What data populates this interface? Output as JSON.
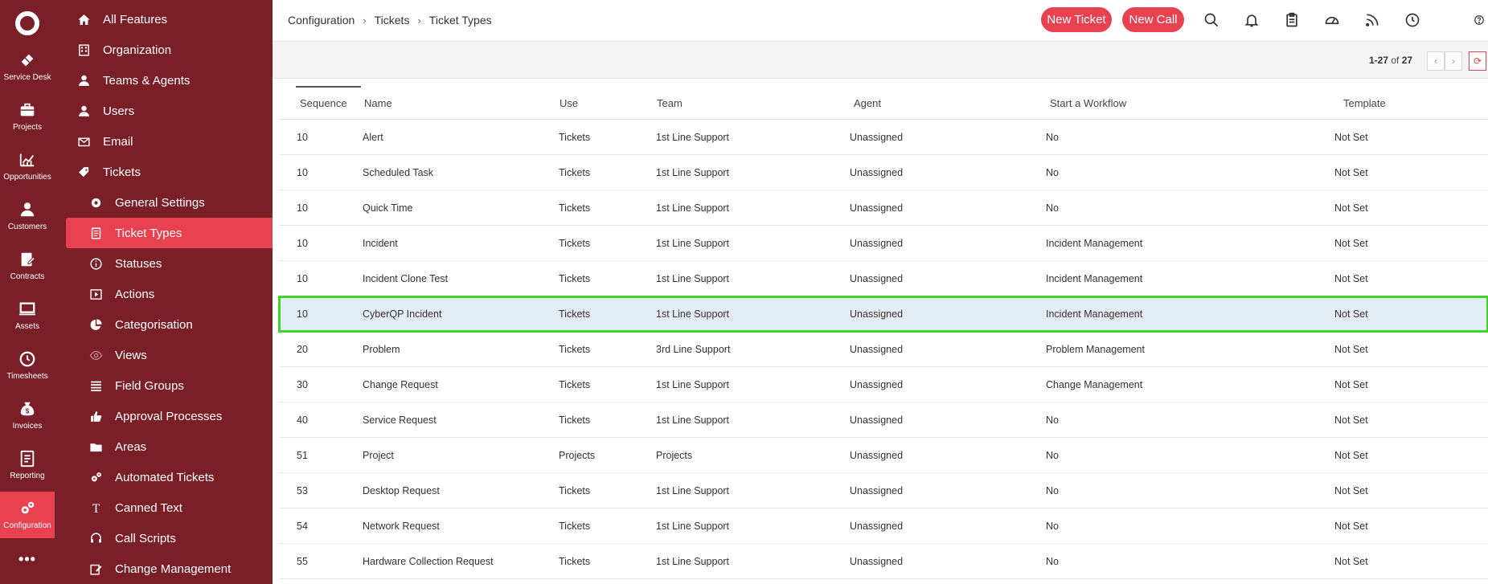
{
  "rail": [
    {
      "label": "Service Desk",
      "icon": "ticket-icon"
    },
    {
      "label": "Projects",
      "icon": "briefcase-icon"
    },
    {
      "label": "Opportunities",
      "icon": "chart-icon"
    },
    {
      "label": "Customers",
      "icon": "person-icon"
    },
    {
      "label": "Contracts",
      "icon": "contract-icon"
    },
    {
      "label": "Assets",
      "icon": "monitor-icon"
    },
    {
      "label": "Timesheets",
      "icon": "clock-icon"
    },
    {
      "label": "Invoices",
      "icon": "money-bag-icon"
    },
    {
      "label": "Reporting",
      "icon": "report-icon"
    },
    {
      "label": "Configuration",
      "icon": "gears-icon",
      "active": true
    }
  ],
  "rail_more": "•••",
  "nav": [
    {
      "label": "All Features",
      "icon": "home-icon",
      "level": 1
    },
    {
      "label": "Organization",
      "icon": "building-icon",
      "level": 1
    },
    {
      "label": "Teams & Agents",
      "icon": "person-icon",
      "level": 1
    },
    {
      "label": "Users",
      "icon": "user-icon",
      "level": 1
    },
    {
      "label": "Email",
      "icon": "envelope-icon",
      "level": 1
    },
    {
      "label": "Tickets",
      "icon": "tag-icon",
      "level": 1
    },
    {
      "label": "General Settings",
      "icon": "gear-icon",
      "level": 2
    },
    {
      "label": "Ticket Types",
      "icon": "document-icon",
      "level": 2,
      "active": true
    },
    {
      "label": "Statuses",
      "icon": "info-icon",
      "level": 2
    },
    {
      "label": "Actions",
      "icon": "play-icon",
      "level": 2
    },
    {
      "label": "Categorisation",
      "icon": "pie-icon",
      "level": 2
    },
    {
      "label": "Views",
      "icon": "eye-icon",
      "level": 2
    },
    {
      "label": "Field Groups",
      "icon": "list-icon",
      "level": 2
    },
    {
      "label": "Approval Processes",
      "icon": "thumbs-up-icon",
      "level": 2
    },
    {
      "label": "Areas",
      "icon": "folder-icon",
      "level": 2
    },
    {
      "label": "Automated Tickets",
      "icon": "gears-icon",
      "level": 2
    },
    {
      "label": "Canned Text",
      "icon": "text-icon",
      "level": 2
    },
    {
      "label": "Call Scripts",
      "icon": "headset-icon",
      "level": 2
    },
    {
      "label": "Change Management",
      "icon": "edit-icon",
      "level": 2
    }
  ],
  "header": {
    "breadcrumb": [
      "Configuration",
      "Tickets",
      "Ticket Types"
    ],
    "new_ticket_label": "New Ticket",
    "new_call_label": "New Call",
    "icons": [
      "search-icon",
      "bell-icon",
      "clipboard-icon",
      "gauge-icon",
      "rss-icon",
      "clock-icon",
      "help-icon"
    ]
  },
  "toolbar": {
    "range": "1-27",
    "of_label": "of",
    "total": "27",
    "prev": "‹",
    "next": "›",
    "refresh": "⟳"
  },
  "table": {
    "columns": [
      "Sequence",
      "Name",
      "Use",
      "Team",
      "Agent",
      "Start a Workflow",
      "Template"
    ],
    "rows": [
      [
        "10",
        "Alert",
        "Tickets",
        "1st Line Support",
        "Unassigned",
        "No",
        "Not Set"
      ],
      [
        "10",
        "Scheduled Task",
        "Tickets",
        "1st Line Support",
        "Unassigned",
        "No",
        "Not Set"
      ],
      [
        "10",
        "Quick Time",
        "Tickets",
        "1st Line Support",
        "Unassigned",
        "No",
        "Not Set"
      ],
      [
        "10",
        "Incident",
        "Tickets",
        "1st Line Support",
        "Unassigned",
        "Incident Management",
        "Not Set"
      ],
      [
        "10",
        "Incident Clone Test",
        "Tickets",
        "1st Line Support",
        "Unassigned",
        "Incident Management",
        "Not Set"
      ],
      [
        "10",
        "CyberQP Incident",
        "Tickets",
        "1st Line Support",
        "Unassigned",
        "Incident Management",
        "Not Set"
      ],
      [
        "20",
        "Problem",
        "Tickets",
        "3rd Line Support",
        "Unassigned",
        "Problem Management",
        "Not Set"
      ],
      [
        "30",
        "Change Request",
        "Tickets",
        "1st Line Support",
        "Unassigned",
        "Change Management",
        "Not Set"
      ],
      [
        "40",
        "Service Request",
        "Tickets",
        "1st Line Support",
        "Unassigned",
        "No",
        "Not Set"
      ],
      [
        "51",
        "Project",
        "Projects",
        "Projects",
        "Unassigned",
        "No",
        "Not Set"
      ],
      [
        "53",
        "Desktop Request",
        "Tickets",
        "1st Line Support",
        "Unassigned",
        "No",
        "Not Set"
      ],
      [
        "54",
        "Network Request",
        "Tickets",
        "1st Line Support",
        "Unassigned",
        "No",
        "Not Set"
      ],
      [
        "55",
        "Hardware Collection Request",
        "Tickets",
        "1st Line Support",
        "Unassigned",
        "No",
        "Not Set"
      ]
    ],
    "selected_row": 5
  },
  "colors": {
    "sidebar": "#7a1f27",
    "accent": "#e8414f",
    "selection_outline": "#3fd62c",
    "selection_bg": "#e4ecf5"
  }
}
